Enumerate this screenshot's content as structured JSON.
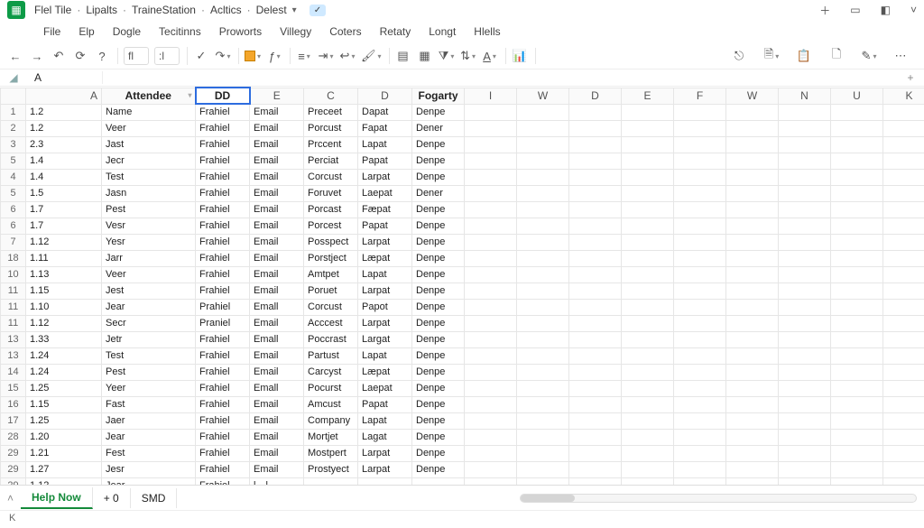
{
  "title": {
    "crumbs": [
      "Flel Tile",
      "Lipalts",
      "TraineStation",
      "Acltics",
      "Delest"
    ],
    "badge": "✓"
  },
  "menubar": [
    "File",
    "Elp",
    "Dogle",
    "Tecitinns",
    "Proworts",
    "Villegy",
    "Coters",
    "Retaty",
    "Longt",
    "Hlells"
  ],
  "namebox": "A",
  "column_labels": [
    "A",
    "Attendee",
    "DD",
    "E",
    "C",
    "D",
    "Fogarty",
    "I",
    "W",
    "D",
    "E",
    "F",
    "W",
    "N",
    "U",
    "K"
  ],
  "extra_header_row": [
    "1",
    "1.2",
    "Name",
    "Frahiel",
    "Email",
    "Preceet",
    "Dapat",
    "Denpe",
    "",
    "",
    "",
    "",
    "",
    "",
    "",
    "",
    ""
  ],
  "rows": [
    {
      "n": "2",
      "a": "1.2",
      "att": "Veer",
      "dd": "Frahiel",
      "e": "Email",
      "c": "Porcust",
      "d": "Fapat",
      "f": "Dener"
    },
    {
      "n": "3",
      "a": "2.3",
      "att": "Jast",
      "dd": "Frahiel",
      "e": "Email",
      "c": "Prccent",
      "d": "Lapat",
      "f": "Denpe"
    },
    {
      "n": "5",
      "a": "1.4",
      "att": "Jecr",
      "dd": "Frahiel",
      "e": "Email",
      "c": "Perciat",
      "d": "Papat",
      "f": "Denpe"
    },
    {
      "n": "4",
      "a": "1.4",
      "att": "Test",
      "dd": "Frahiel",
      "e": "Email",
      "c": "Corcust",
      "d": "Larpat",
      "f": "Denpe"
    },
    {
      "n": "5",
      "a": "1.5",
      "att": "Jasn",
      "dd": "Frahiel",
      "e": "Email",
      "c": "Foruvet",
      "d": "Laepat",
      "f": "Dener"
    },
    {
      "n": "6",
      "a": "1.7",
      "att": "Pest",
      "dd": "Frahiel",
      "e": "Email",
      "c": "Porcast",
      "d": "Fæpat",
      "f": "Denpe"
    },
    {
      "n": "6",
      "a": "1.7",
      "att": "Vesr",
      "dd": "Frahiel",
      "e": "Email",
      "c": "Porcest",
      "d": "Papat",
      "f": "Denpe"
    },
    {
      "n": "7",
      "a": "1.12",
      "att": "Yesr",
      "dd": "Frahiel",
      "e": "Email",
      "c": "Posspect",
      "d": "Larpat",
      "f": "Denpe"
    },
    {
      "n": "18",
      "a": "1.11",
      "att": "Jarr",
      "dd": "Frahiel",
      "e": "Email",
      "c": "Porstject",
      "d": "Læpat",
      "f": "Denpe"
    },
    {
      "n": "10",
      "a": "1.13",
      "att": "Veer",
      "dd": "Frahiel",
      "e": "Email",
      "c": "Amtpet",
      "d": "Lapat",
      "f": "Denpe"
    },
    {
      "n": "11",
      "a": "1.15",
      "att": "Jest",
      "dd": "Frahiel",
      "e": "Email",
      "c": "Poruet",
      "d": "Larpat",
      "f": "Denpe"
    },
    {
      "n": "11",
      "a": "1.10",
      "att": "Jear",
      "dd": "Prahiel",
      "e": "Emall",
      "c": "Corcust",
      "d": "Papot",
      "f": "Denpe"
    },
    {
      "n": "11",
      "a": "1.12",
      "att": "Secr",
      "dd": "Praniel",
      "e": "Email",
      "c": "Acccest",
      "d": "Larpat",
      "f": "Denpe"
    },
    {
      "n": "13",
      "a": "1.33",
      "att": "Jetr",
      "dd": "Frahiel",
      "e": "Emall",
      "c": "Poccrast",
      "d": "Largat",
      "f": "Denpe"
    },
    {
      "n": "13",
      "a": "1.24",
      "att": "Test",
      "dd": "Frahiel",
      "e": "Email",
      "c": "Partust",
      "d": "Lapat",
      "f": "Denpe"
    },
    {
      "n": "14",
      "a": "1.24",
      "att": "Pest",
      "dd": "Frahiel",
      "e": "Email",
      "c": "Carcyst",
      "d": "Læpat",
      "f": "Denpe"
    },
    {
      "n": "15",
      "a": "1.25",
      "att": "Yeer",
      "dd": "Frahiel",
      "e": "Emall",
      "c": "Pocurst",
      "d": "Laepat",
      "f": "Denpe"
    },
    {
      "n": "16",
      "a": "1.15",
      "att": "Fast",
      "dd": "Frahiel",
      "e": "Email",
      "c": "Amcust",
      "d": "Papat",
      "f": "Denpe"
    },
    {
      "n": "17",
      "a": "1.25",
      "att": "Jaer",
      "dd": "Frahiel",
      "e": "Email",
      "c": "Company",
      "d": "Lapat",
      "f": "Denpe"
    },
    {
      "n": "28",
      "a": "1.20",
      "att": "Jear",
      "dd": "Frahiel",
      "e": "Email",
      "c": "Mortjet",
      "d": "Lagat",
      "f": "Denpe"
    },
    {
      "n": "29",
      "a": "1.21",
      "att": "Fest",
      "dd": "Frahiel",
      "e": "Email",
      "c": "Mostpert",
      "d": "Larpat",
      "f": "Denpe"
    },
    {
      "n": "29",
      "a": "1.27",
      "att": "Jesr",
      "dd": "Frahiel",
      "e": "Email",
      "c": "Prostyect",
      "d": "Larpat",
      "f": "Denpe"
    },
    {
      "n": "29",
      "a": "1.12",
      "att": "Jear",
      "dd": "Frahiel",
      "e": "l…l",
      "c": "",
      "d": "",
      "f": ""
    }
  ],
  "sheet_tabs": {
    "active": "Help Now",
    "others": [
      "0",
      "SMD"
    ],
    "plus": "+"
  },
  "status": "K"
}
